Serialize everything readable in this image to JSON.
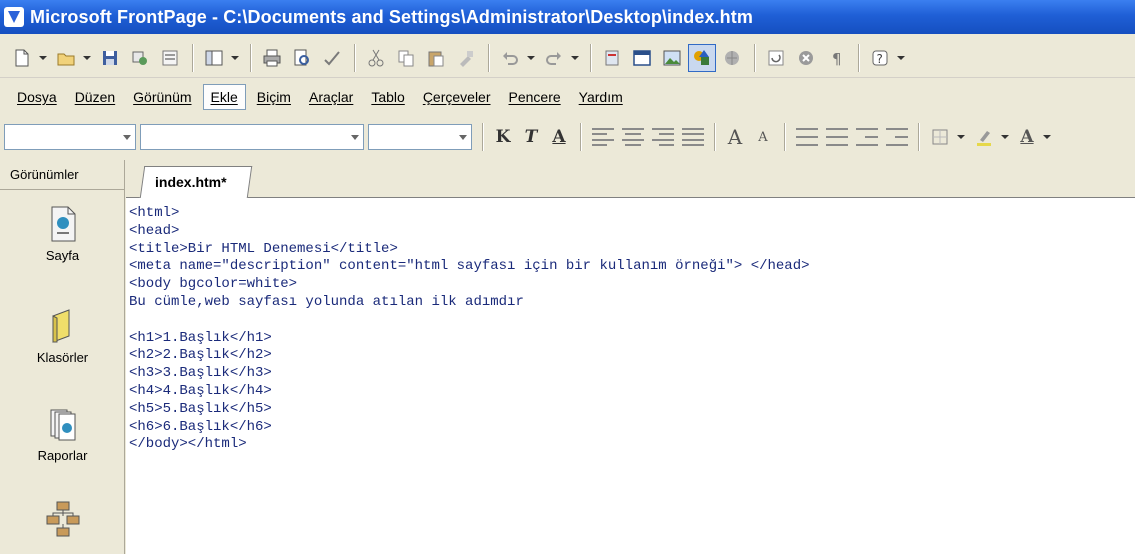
{
  "window": {
    "title": "Microsoft FrontPage - C:\\Documents and Settings\\Administrator\\Desktop\\index.htm"
  },
  "toolbar": {
    "buttons": [
      "new-page-icon",
      "open-icon",
      "save-icon",
      "publish-icon",
      "folder-list-icon",
      "toggle-pane-icon",
      "print-icon",
      "print-preview-icon",
      "spelling-icon",
      "cut-icon",
      "copy-icon",
      "paste-icon",
      "format-painter-icon",
      "undo-icon",
      "redo-icon",
      "web-component-icon",
      "insert-table-icon",
      "insert-picture-icon",
      "drawing-icon",
      "hyperlink-icon",
      "refresh-icon",
      "stop-icon",
      "show-all-icon",
      "help-icon"
    ]
  },
  "menu": {
    "items": [
      "Dosya",
      "Düzen",
      "Görünüm",
      "Ekle",
      "Biçim",
      "Araçlar",
      "Tablo",
      "Çerçeveler",
      "Pencere",
      "Yardım"
    ],
    "active_index": 3
  },
  "format": {
    "bold_label": "K",
    "italic_label": "T",
    "underline_label": "A",
    "grow_font_label": "A",
    "shrink_font_label": "A",
    "font_color_label": "A"
  },
  "views": {
    "header": "Görünümler",
    "items": [
      {
        "label": "Sayfa",
        "icon": "page-view-icon"
      },
      {
        "label": "Klasörler",
        "icon": "folders-view-icon"
      },
      {
        "label": "Raporlar",
        "icon": "reports-view-icon"
      },
      {
        "label": "",
        "icon": "navigation-view-icon"
      }
    ]
  },
  "editor": {
    "tab_label": "index.htm*",
    "lines": [
      "<html>",
      "<head>",
      "<title>Bir HTML Denemesi</title>",
      "<meta name=\"description\" content=\"html sayfası için bir kullanım örneği\"> </head>",
      "<body bgcolor=white>",
      "Bu cümle,web sayfası yolunda atılan ilk adımdır",
      "",
      "<h1>1.Başlık</h1>",
      "<h2>2.Başlık</h2>",
      "<h3>3.Başlık</h3>",
      "<h4>4.Başlık</h4>",
      "<h5>5.Başlık</h5>",
      "<h6>6.Başlık</h6>",
      "</body></html>"
    ]
  },
  "colors": {
    "titlebar": "#1f5fd6",
    "code_text": "#1a2a7a",
    "chrome": "#ece9d8"
  }
}
